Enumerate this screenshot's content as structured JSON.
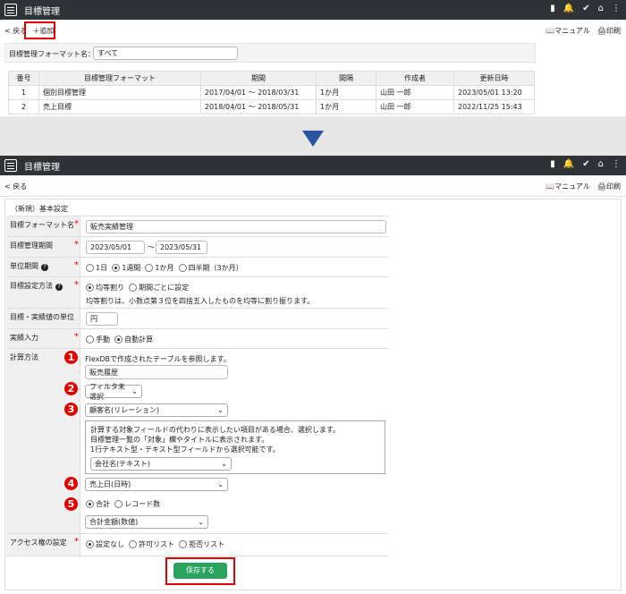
{
  "top": {
    "title": "目標管理",
    "back": "戻る",
    "add": "追加",
    "manual": "マニュアル",
    "print": "印刷",
    "filter_label": "目標管理フォーマット名：",
    "filter_value": "すべて",
    "columns": [
      "番号",
      "目標管理フォーマット",
      "期間",
      "間隔",
      "作成者",
      "更新日時"
    ],
    "rows": [
      [
        "1",
        "個別目標管理",
        "2017/04/01 ～ 2018/03/31",
        "1か月",
        "山田 一郎",
        "2023/05/01 13:20"
      ],
      [
        "2",
        "売上目標",
        "2018/04/01 ～ 2018/05/31",
        "1か月",
        "山田 一郎",
        "2022/11/25 15:43"
      ]
    ]
  },
  "bottom": {
    "title": "目標管理",
    "back": "戻る",
    "manual": "マニュアル",
    "print": "印刷",
    "section": "（新規）基本設定",
    "fields": {
      "format_name_label": "目標フォーマット名",
      "format_name_value": "販売実績管理",
      "period_label": "目標管理期間",
      "period_from": "2023/05/01",
      "period_sep": "～",
      "period_to": "2023/05/31",
      "unit_label": "単位期間",
      "unit_options": [
        "1日",
        "1週間",
        "1か月",
        "四半期（3か月）"
      ],
      "method_label": "目標設定方法",
      "method_options": [
        "均等割り",
        "期間ごとに設定"
      ],
      "method_note": "均等割りは、小数点第３位を四捨五入したものを均等に割り振ります。",
      "unit_value_label": "目標・実績値の単位",
      "unit_value": "円",
      "actual_label": "実績入力",
      "actual_options": [
        "手動",
        "自動計算"
      ],
      "calc_label": "計算方法",
      "calc_note": "FlexDBで作成されたテーブルを参照します。",
      "table_value": "販売履歴",
      "filter_select": "フィルタ未選択",
      "target_select": "顧客名(リレーション)",
      "target_note": [
        "計算する対象フィールドの代わりに表示したい項目がある場合、選択します。",
        "目標管理一覧の「対象」欄やタイトルに表示されます。",
        "1行テキスト型・テキスト型フィールドから選択可能です。"
      ],
      "display_select": "会社名(テキスト)",
      "date_select": "売上日(日時)",
      "agg_options": [
        "合計",
        "レコード数"
      ],
      "agg_field_select": "合計金額(数値)",
      "access_label": "アクセス権の設定",
      "access_options": [
        "設定なし",
        "許可リスト",
        "拒否リスト"
      ]
    },
    "save": "保存する",
    "numbers": [
      "1",
      "2",
      "3",
      "4",
      "5"
    ]
  }
}
